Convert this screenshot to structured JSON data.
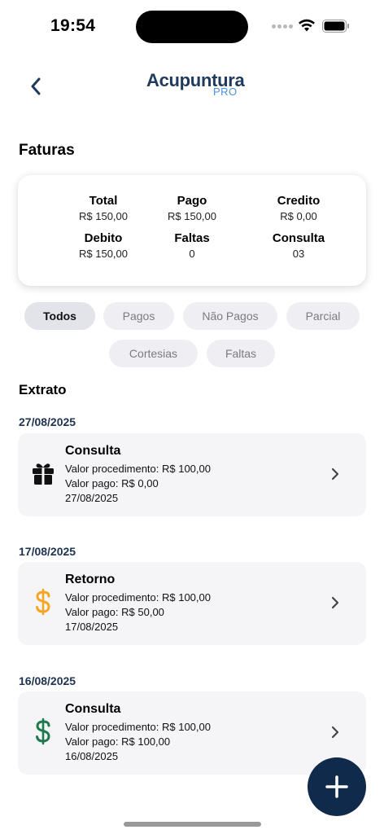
{
  "status": {
    "time": "19:54"
  },
  "header": {
    "logo_main": "Acupuntura",
    "logo_sub": "PRO"
  },
  "page": {
    "title": "Faturas"
  },
  "summary": {
    "total": {
      "label": "Total",
      "value": "R$ 150,00"
    },
    "pago": {
      "label": "Pago",
      "value": "R$ 150,00"
    },
    "credito": {
      "label": "Credito",
      "value": "R$ 0,00"
    },
    "debito": {
      "label": "Debito",
      "value": "R$ 150,00"
    },
    "faltas": {
      "label": "Faltas",
      "value": "0"
    },
    "consulta": {
      "label": "Consulta",
      "value": "03"
    }
  },
  "filters": {
    "todos": "Todos",
    "pagos": "Pagos",
    "nao_pagos": "Não Pagos",
    "parcial": "Parcial",
    "cortesias": "Cortesias",
    "faltas": "Faltas",
    "active": "Todos"
  },
  "extrato": {
    "title": "Extrato",
    "entries": [
      {
        "date": "27/08/2025",
        "title": "Consulta",
        "procedimento": "Valor procedimento: R$ 100,00",
        "pago": "Valor pago: R$ 0,00",
        "data": "27/08/2025",
        "icon": "gift-icon",
        "icon_color": "#111111"
      },
      {
        "date": "17/08/2025",
        "title": "Retorno",
        "procedimento": "Valor procedimento: R$ 100,00",
        "pago": "Valor pago: R$ 50,00",
        "data": "17/08/2025",
        "icon": "dollar-icon",
        "icon_color": "#f5a623"
      },
      {
        "date": "16/08/2025",
        "title": "Consulta",
        "procedimento": "Valor procedimento: R$ 100,00",
        "pago": "Valor pago: R$ 100,00",
        "data": "16/08/2025",
        "icon": "dollar-icon",
        "icon_color": "#1e7a4a"
      }
    ]
  },
  "colors": {
    "brand": "#0f2a4a",
    "accent": "#4a90d9"
  }
}
